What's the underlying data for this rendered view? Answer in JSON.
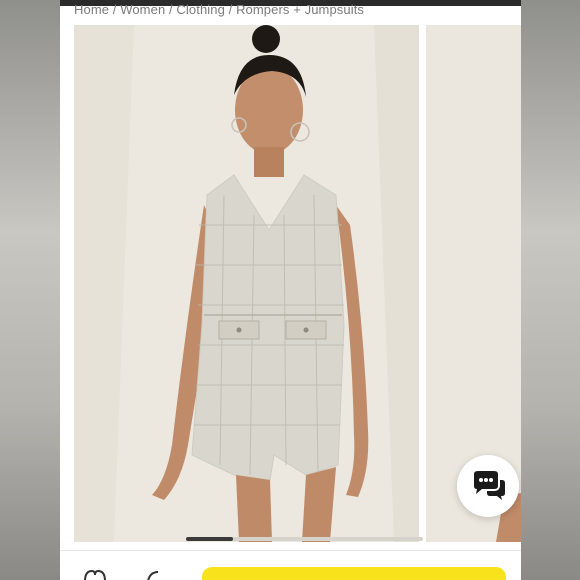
{
  "breadcrumb": {
    "items": [
      "Home",
      "Women",
      "Clothing",
      "Rompers + Jumpsuits"
    ],
    "separator": " / "
  },
  "gallery": {
    "active_index": 0,
    "slides": [
      {
        "label": "main-product-photo"
      },
      {
        "label": "next-product-photo"
      }
    ],
    "scroll_progress": 0.2
  },
  "chat": {
    "icon": "chat-bubbles-icon"
  },
  "bottom_bar": {
    "add_to_bag_label": ""
  },
  "colors": {
    "accent": "#f7e21b",
    "topbar": "#2b2b2b",
    "text_muted": "#7b7b7b"
  }
}
